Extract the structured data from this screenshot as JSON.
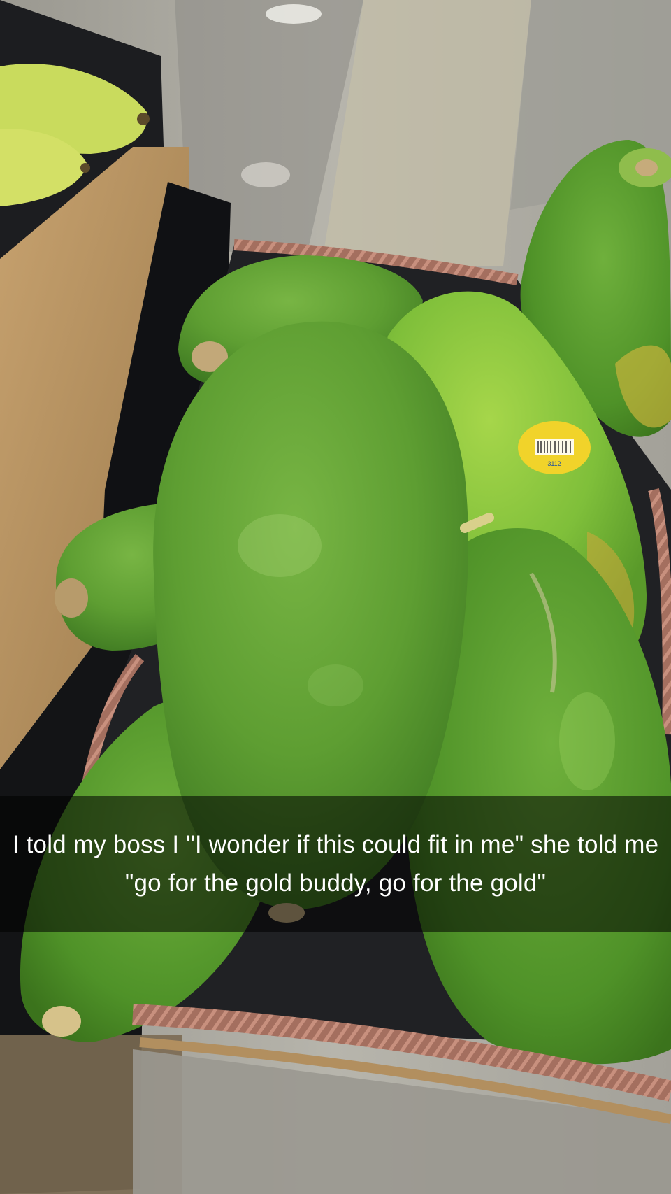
{
  "photo": {
    "subject": "papayas-in-wicker-basket-at-grocery-store",
    "produce_sticker_code": "3112"
  },
  "caption": {
    "text": "I told my boss I \"I wonder if this could fit in me\" she told me \"go for the gold buddy, go for the gold\""
  },
  "colors": {
    "papaya_green": "#5fa431",
    "papaya_light": "#8cc43f",
    "basket": "#a46f5f",
    "sticker": "#f1d32a",
    "caption_bg": "rgba(0,0,0,0.55)"
  }
}
